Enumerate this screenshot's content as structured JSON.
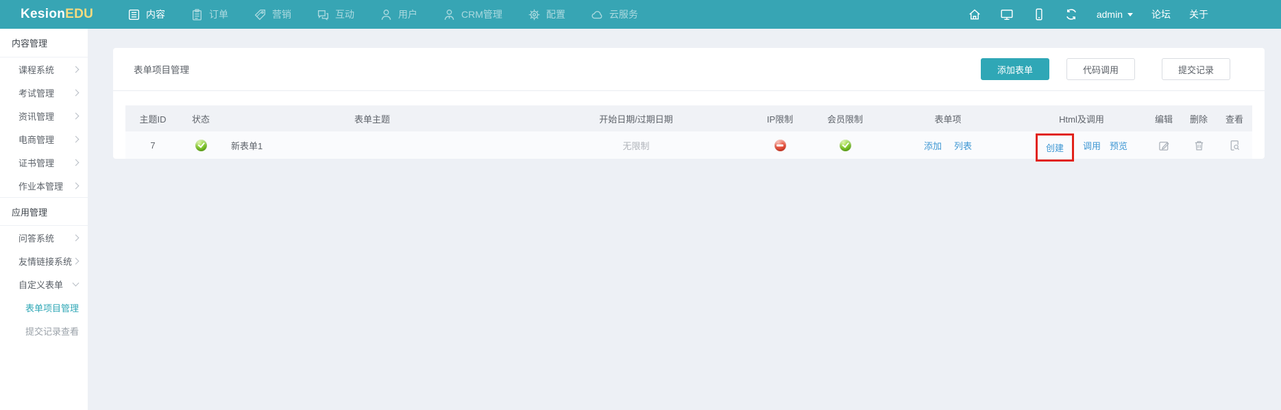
{
  "topbar": {
    "logo_prefix": "Kesion",
    "logo_suffix": "EDU",
    "nav": [
      {
        "label": "内容",
        "icon": "content-icon",
        "active": true
      },
      {
        "label": "订单",
        "icon": "orders-icon",
        "active": false
      },
      {
        "label": "营销",
        "icon": "marketing-icon",
        "active": false
      },
      {
        "label": "互动",
        "icon": "interaction-icon",
        "active": false
      },
      {
        "label": "用户",
        "icon": "users-icon",
        "active": false
      },
      {
        "label": "CRM管理",
        "icon": "crm-icon",
        "active": false
      },
      {
        "label": "配置",
        "icon": "config-icon",
        "active": false
      },
      {
        "label": "云服务",
        "icon": "cloud-icon",
        "active": false
      }
    ],
    "right_icons": [
      "home-icon",
      "monitor-icon",
      "mobile-icon",
      "refresh-icon"
    ],
    "username": "admin",
    "right_links": [
      {
        "label": "论坛"
      },
      {
        "label": "关于"
      }
    ]
  },
  "sidebar": {
    "sections": [
      {
        "title": "内容管理",
        "items": [
          {
            "label": "课程系统"
          },
          {
            "label": "考试管理"
          },
          {
            "label": "资讯管理"
          },
          {
            "label": "电商管理"
          },
          {
            "label": "证书管理"
          },
          {
            "label": "作业本管理"
          }
        ]
      },
      {
        "title": "应用管理",
        "items": [
          {
            "label": "问答系统"
          },
          {
            "label": "友情链接系统"
          },
          {
            "label": "自定义表单",
            "expanded": true
          }
        ],
        "subitems": [
          {
            "label": "表单项目管理",
            "active": true
          },
          {
            "label": "提交记录查看",
            "active": false
          }
        ]
      }
    ]
  },
  "main": {
    "title": "表单项目管理",
    "buttons": {
      "add": "添加表单",
      "code": "代码调用",
      "records": "提交记录"
    },
    "table": {
      "headers": [
        "主题ID",
        "状态",
        "表单主题",
        "开始日期/过期日期",
        "IP限制",
        "会员限制",
        "表单项",
        "Html及调用",
        "编辑",
        "删除",
        "查看"
      ],
      "row": {
        "id": "7",
        "status": "enabled",
        "title": "新表单1",
        "date_range": "无限制",
        "ip_limit": "blocked",
        "member_limit": "allowed",
        "form_item_links": [
          "添加",
          "列表"
        ],
        "html_links": [
          "创建",
          "调用",
          "预览"
        ],
        "annotated_link": "创建"
      }
    }
  },
  "colors": {
    "accent": "#37a5b4",
    "logo_accent": "#f6db7f",
    "link": "#3e97d3",
    "status_green": "#61b013",
    "status_red": "#d92f1a",
    "annotation": "#e12219"
  }
}
